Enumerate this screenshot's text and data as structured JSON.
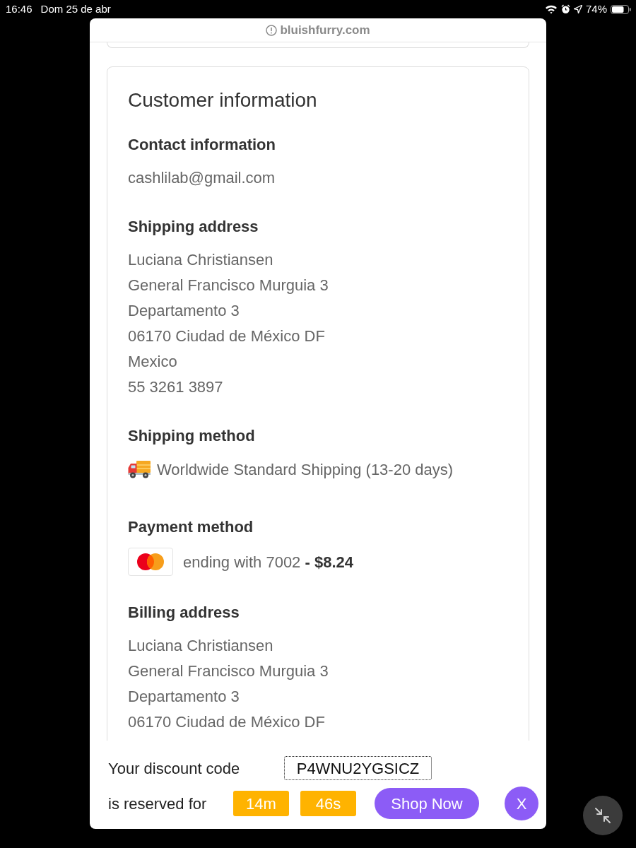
{
  "status_bar": {
    "time": "16:46",
    "date": "Dom 25 de abr",
    "battery": "74%"
  },
  "browser": {
    "url": "bluishfurry.com"
  },
  "customer_information": {
    "title": "Customer information",
    "sections": [
      {
        "kind": "text",
        "heading": "Contact information",
        "lines": [
          "cashlilab@gmail.com"
        ]
      },
      {
        "kind": "text",
        "heading": "Shipping address",
        "lines": [
          "Luciana Christiansen",
          "General Francisco Murguia 3",
          "Departamento 3",
          "06170 Ciudad de México DF",
          "Mexico",
          "55 3261 3897"
        ]
      },
      {
        "kind": "shipping",
        "heading": "Shipping method",
        "text": "Worldwide Standard Shipping (13-20 days)"
      },
      {
        "kind": "payment",
        "heading": "Payment method",
        "text": "ending with 7002 **- $8.24**"
      },
      {
        "kind": "text",
        "heading": "Billing address",
        "lines": [
          "Luciana Christiansen",
          "General Francisco Murguia 3",
          "Departamento 3",
          "06170 Ciudad de México DF"
        ]
      }
    ]
  },
  "discount_bar": {
    "label": "Your discount code",
    "code": "P4WNU2YGSICZ",
    "reserved_label": "is reserved for",
    "timer": [
      "14m",
      "46s"
    ],
    "shop_button": "Shop Now",
    "close_button": "X"
  }
}
